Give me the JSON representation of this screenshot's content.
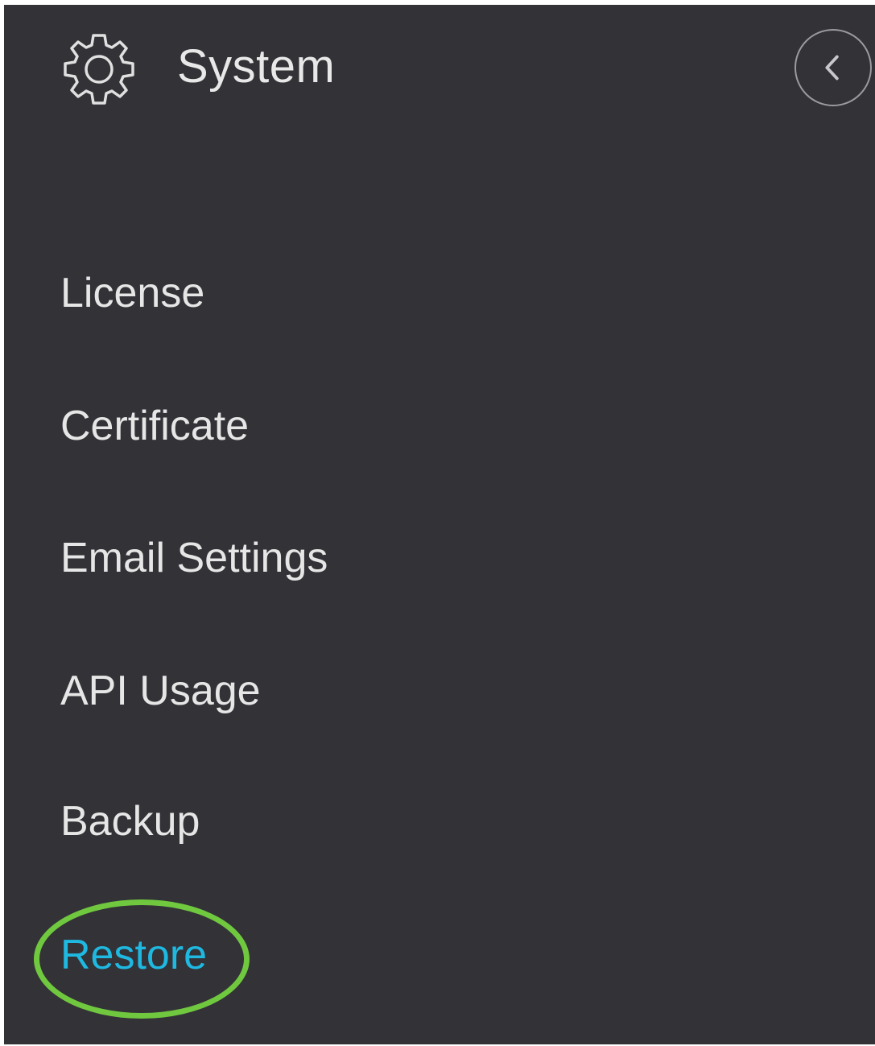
{
  "header": {
    "title": "System",
    "icon": "gear-icon",
    "collapse_icon": "chevron-left-icon"
  },
  "menu": {
    "items": [
      {
        "label": "License"
      },
      {
        "label": "Certificate"
      },
      {
        "label": "Email Settings"
      },
      {
        "label": "API Usage"
      },
      {
        "label": "Backup"
      },
      {
        "label": "Restore",
        "active": true
      }
    ]
  },
  "colors": {
    "panel_background": "#323237",
    "text": "#e6e6e6",
    "active_text": "#1fb8e0",
    "highlight_ring": "#70c83f"
  }
}
